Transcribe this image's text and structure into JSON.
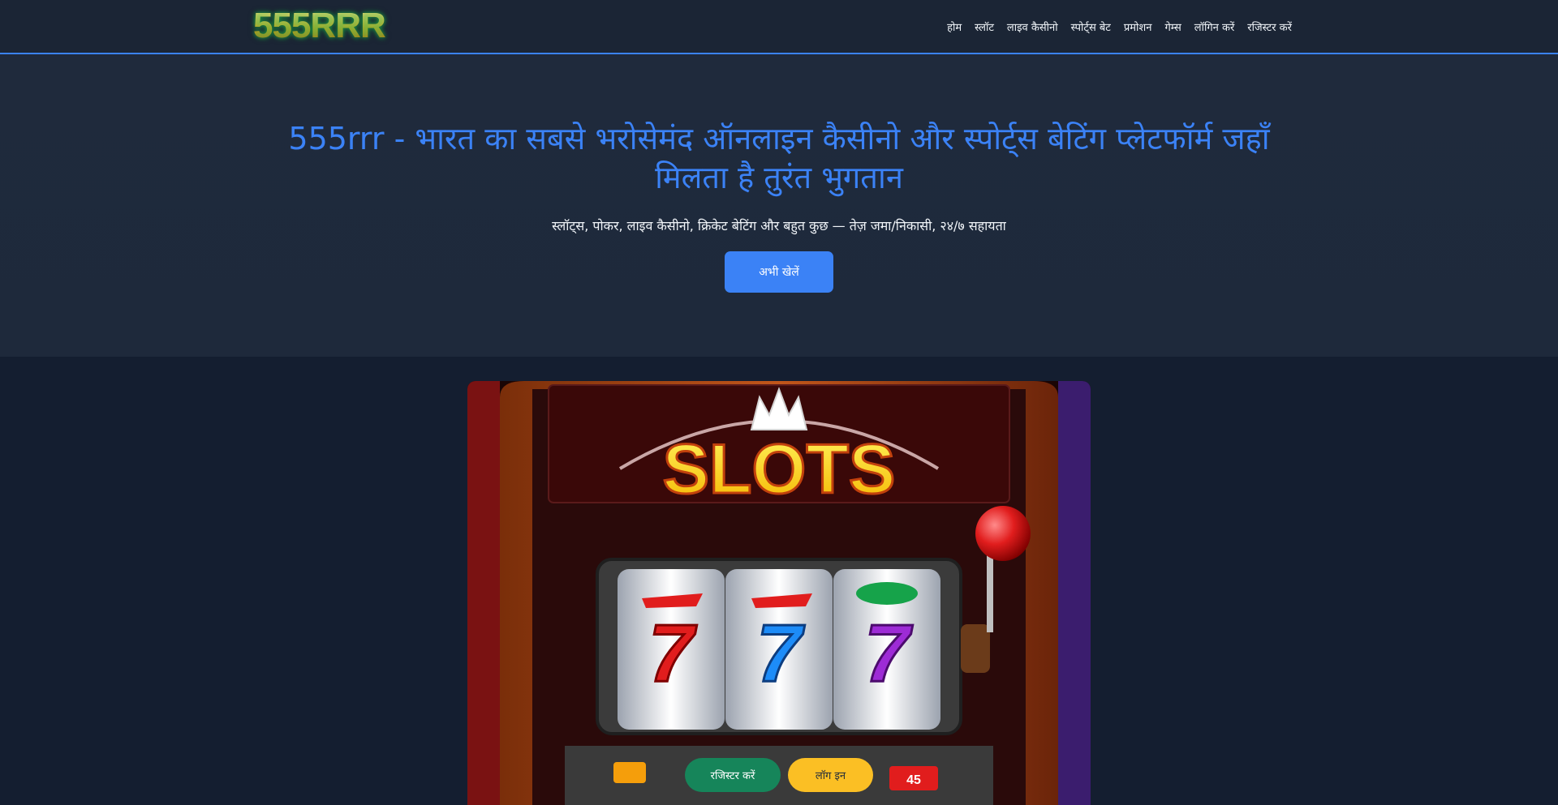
{
  "header": {
    "logo_text": "555RRR",
    "nav": [
      "होम",
      "स्लॉट",
      "लाइव कैसीनो",
      "स्पोर्ट्स बेट",
      "प्रमोशन",
      "गेम्स",
      "लॉगिन करें",
      "रजिस्टर करें"
    ]
  },
  "hero": {
    "title_brand": "555rrr",
    "title_rest": " - भारत का सबसे भरोसेमंद ऑनलाइन कैसीनो और स्पोर्ट्स बेटिंग प्लेटफॉर्म जहाँ मिलता है तुरंत भुगतान",
    "subtitle": "स्लॉट्स, पोकर, लाइव कैसीनो, क्रिकेट बेटिंग और बहुत कुछ — तेज़ जमा/निकासी, २४/७ सहायता",
    "cta_label": "अभी खेलें"
  },
  "banner": {
    "title": "SLOTS",
    "reel_symbols": [
      "7",
      "7",
      "7"
    ],
    "bottom_numbers": [
      "45"
    ]
  },
  "floating": {
    "green_label": "रजिस्टर करें",
    "yellow_label": "लॉग इन"
  },
  "colors": {
    "accent": "#3b82f6",
    "header_bg": "#1b2535",
    "body_bg": "#141e30",
    "green": "#16855a",
    "yellow": "#fbbf24"
  }
}
